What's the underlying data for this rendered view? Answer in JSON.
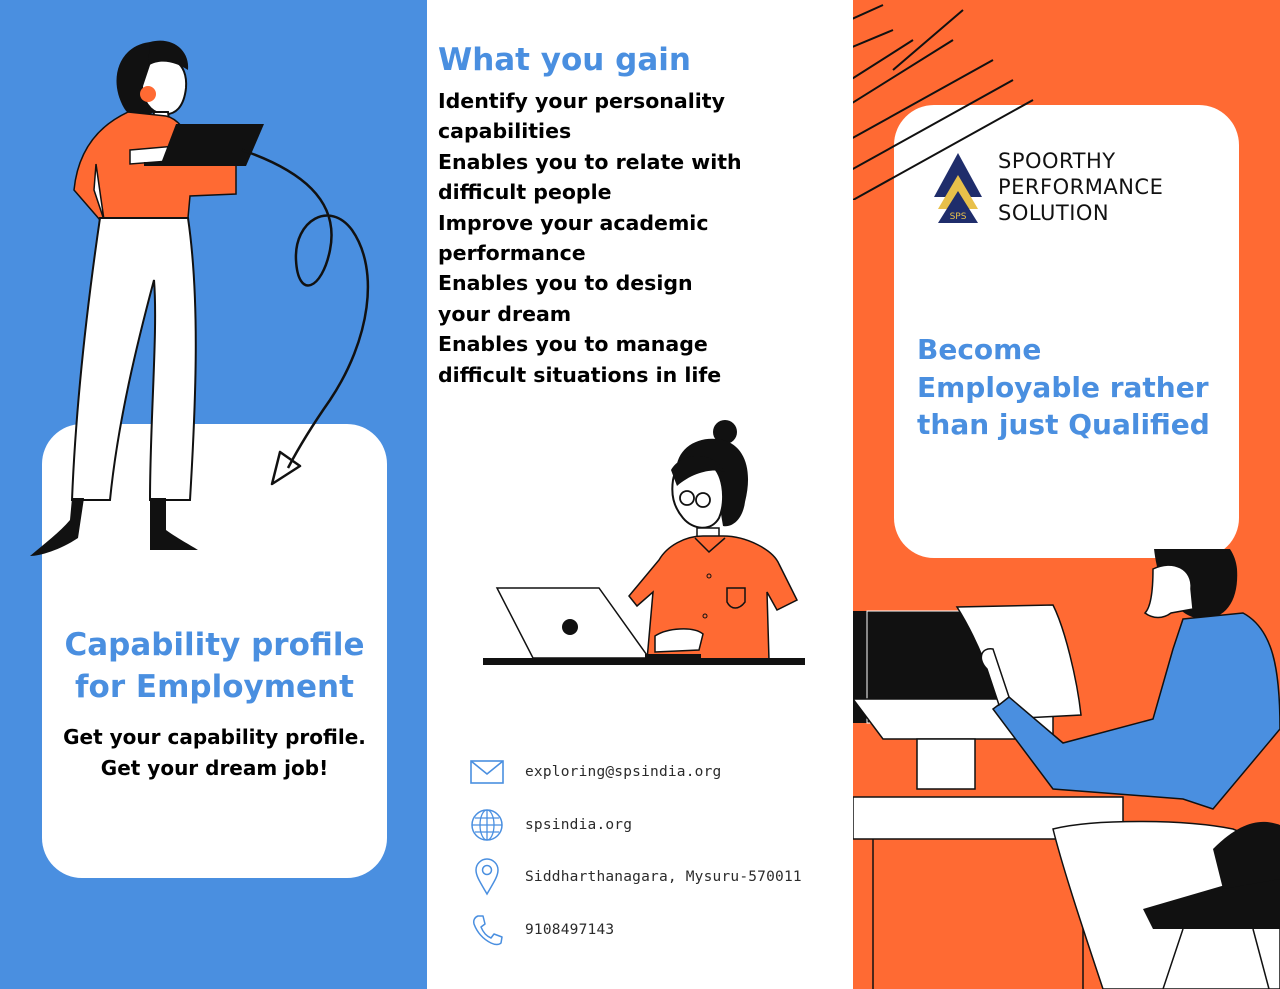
{
  "colors": {
    "blue": "#4A8FE0",
    "orange": "#FF6A33",
    "heading_blue": "#4A8FE0",
    "dark": "#111111",
    "logo_navy": "#1F2D6B",
    "logo_gold": "#E8C04A"
  },
  "left_panel": {
    "title_line1": "Capability profile",
    "title_line2": "for Employment",
    "sub_line1": "Get your capability profile.",
    "sub_line2": "Get your dream job!"
  },
  "middle_panel": {
    "title": "What you gain",
    "benefits": [
      "Identify your personality capabilities",
      "Enables you to relate with difficult people",
      "Improve your academic performance",
      "Enables you to design your dream",
      "Enables you to manage difficult situations in life"
    ],
    "contacts": [
      {
        "icon": "mail-icon",
        "text": "exploring@spsindia.org"
      },
      {
        "icon": "globe-icon",
        "text": "spsindia.org"
      },
      {
        "icon": "location-pin-icon",
        "text": "Siddharthanagara, Mysuru-570011"
      },
      {
        "icon": "phone-icon",
        "text": "9108497143"
      }
    ]
  },
  "right_panel": {
    "brand_line1": "SPOORTHY",
    "brand_line2": "PERFORMANCE",
    "brand_line3": "SOLUTION",
    "logo_mark": "SPS",
    "tagline": "Become Employable rather than just Qualified"
  }
}
